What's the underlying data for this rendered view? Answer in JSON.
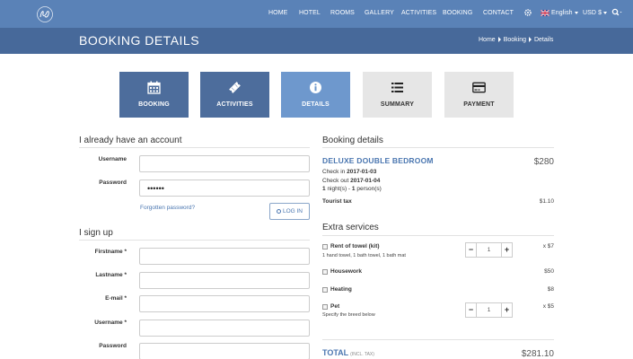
{
  "nav": {
    "items": [
      "HOME",
      "HOTEL",
      "ROOMS",
      "GALLERY",
      "ACTIVITIES",
      "BOOKING",
      "CONTACT"
    ],
    "language": "English",
    "currency": "USD $"
  },
  "header": {
    "title": "BOOKING DETAILS",
    "breadcrumb": [
      "Home",
      "Booking",
      "Details"
    ]
  },
  "steps": [
    {
      "label": "BOOKING",
      "icon": "calendar-icon",
      "state": "done"
    },
    {
      "label": "ACTIVITIES",
      "icon": "ticket-icon",
      "state": "done"
    },
    {
      "label": "DETAILS",
      "icon": "info-icon",
      "state": "active"
    },
    {
      "label": "SUMMARY",
      "icon": "list-icon",
      "state": "todo"
    },
    {
      "label": "PAYMENT",
      "icon": "credit-card-icon",
      "state": "todo"
    }
  ],
  "account": {
    "title": "I already have an account",
    "username_label": "Username",
    "password_label": "Password",
    "password_value": "••••••",
    "forgot_label": "Forgotten password?",
    "login_label": "LOG IN"
  },
  "signup": {
    "title": "I sign up",
    "firstname_label": "Firstname *",
    "lastname_label": "Lastname *",
    "email_label": "E-mail *",
    "username_label": "Username *",
    "password_label": "Password"
  },
  "booking": {
    "title": "Booking details",
    "room_name": "DELUXE DOUBLE BEDROOM",
    "room_price": "$280",
    "checkin_label": "Check in",
    "checkin_date": "2017-01-03",
    "checkout_label": "Check out",
    "checkout_date": "2017-01-04",
    "nights_count": "1",
    "nights_label": "night(s) -",
    "persons_count": "1",
    "persons_label": "person(s)",
    "tax_label": "Tourist tax",
    "tax_price": "$1.10"
  },
  "extras": {
    "title": "Extra services",
    "items": [
      {
        "name": "Rent of towel (kit)",
        "desc": "1 hand towel, 1 bath towel, 1 bath mat",
        "qty": "1",
        "price": "x $7"
      },
      {
        "name": "Housework",
        "desc": "",
        "price": "$50"
      },
      {
        "name": "Heating",
        "desc": "",
        "price": "$8"
      },
      {
        "name": "Pet",
        "desc": "Specify the breed below",
        "qty": "1",
        "price": "x $5"
      }
    ]
  },
  "total": {
    "label": "TOTAL",
    "note": "(INCL. TAX)",
    "price": "$281.10"
  }
}
